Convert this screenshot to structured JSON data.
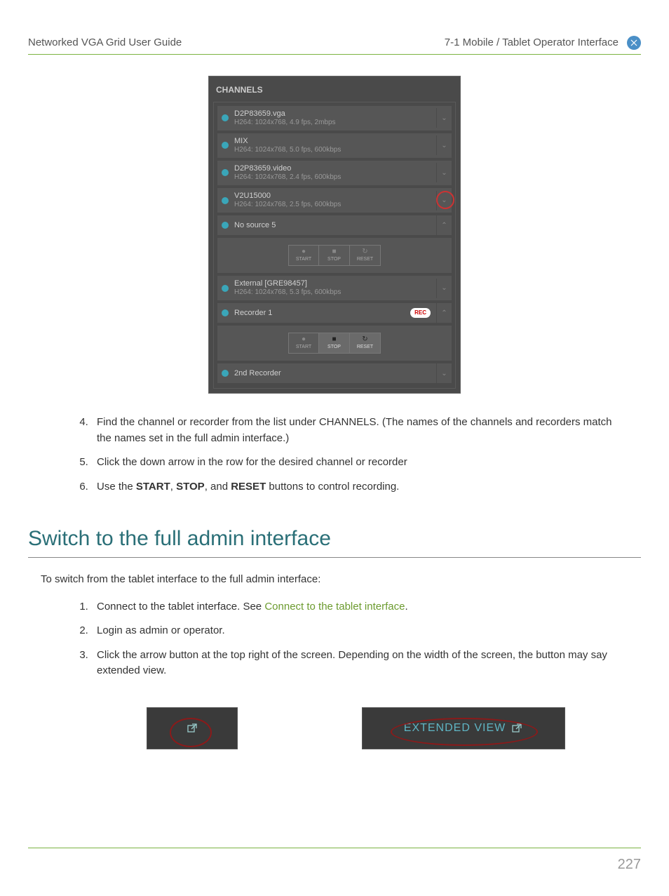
{
  "header": {
    "left": "Networked VGA Grid User Guide",
    "right": "7-1 Mobile / Tablet Operator Interface"
  },
  "panel": {
    "title": "CHANNELS",
    "rows": [
      {
        "name": "D2P83659.vga",
        "spec": "H264: 1024x768, 4.9 fps, 2mbps",
        "arrow": "down"
      },
      {
        "name": "MIX",
        "spec": "H264: 1024x768, 5.0 fps, 600kbps",
        "arrow": "down"
      },
      {
        "name": "D2P83659.video",
        "spec": "H264: 1024x768, 2.4 fps, 600kbps",
        "arrow": "down"
      },
      {
        "name": "V2U15000",
        "spec": "H264: 1024x768, 2.5 fps, 600kbps",
        "arrow": "down",
        "highlighted": true
      },
      {
        "name": "No source 5",
        "spec": "",
        "arrow": "up"
      },
      {
        "controls": true,
        "active": false
      },
      {
        "name": "External [GRE98457]",
        "spec": "H264: 1024x768, 5.3 fps, 600kbps",
        "arrow": "down"
      },
      {
        "name": "Recorder 1",
        "spec": "",
        "arrow": "up",
        "rec": true
      },
      {
        "controls": true,
        "active": true
      },
      {
        "name": "2nd Recorder",
        "spec": "",
        "arrow": "down"
      }
    ],
    "controlLabels": {
      "start": "START",
      "stop": "STOP",
      "reset": "RESET"
    }
  },
  "steps1": [
    "Find the channel or recorder from the list under CHANNELS. (The names of the channels and recorders match the names set in the full admin interface.)",
    "Click the down arrow in the row for the desired channel or recorder",
    "Use the START, STOP, and RESET buttons to control recording."
  ],
  "step6_parts": {
    "prefix": "Use the ",
    "b1": "START",
    "mid1": ", ",
    "b2": "STOP",
    "mid2": ", and ",
    "b3": "RESET",
    "suffix": " buttons to control recording."
  },
  "section2": {
    "title": "Switch to the full admin interface",
    "intro": "To switch from the tablet interface to the full admin interface:",
    "steps": [
      {
        "text": "Connect to the tablet interface. See ",
        "link": "Connect to the tablet interface",
        "after": "."
      },
      {
        "text": "Login as admin or operator."
      },
      {
        "text": "Click the arrow button at the top right of the screen. Depending on the width of the screen, the button may say extended view."
      }
    ]
  },
  "extendedViewLabel": "EXTENDED VIEW",
  "recLabel": "REC",
  "pageNumber": "227"
}
